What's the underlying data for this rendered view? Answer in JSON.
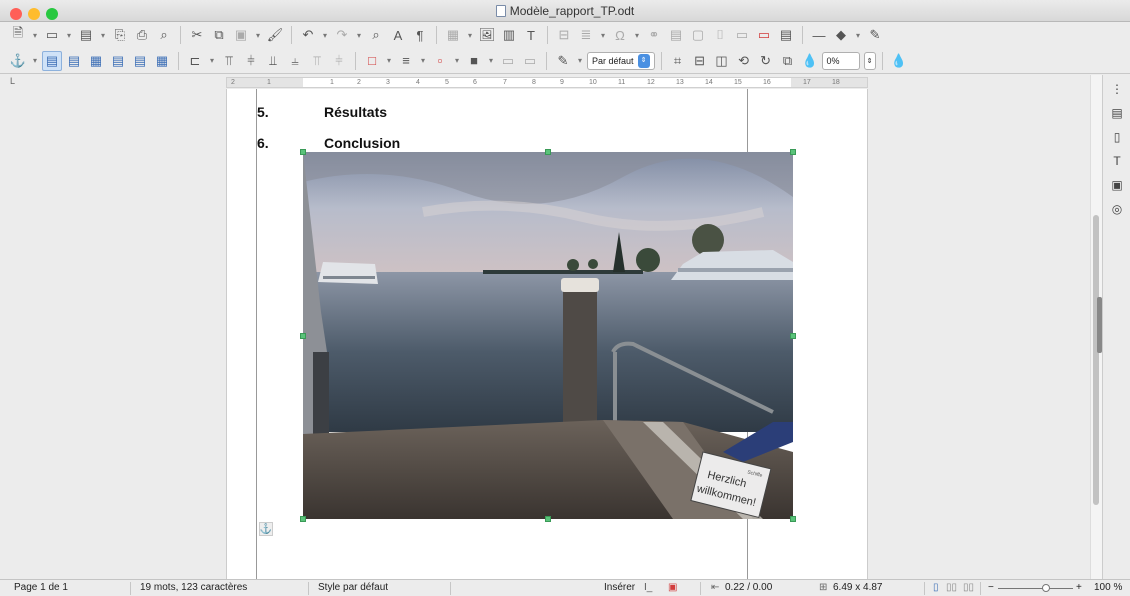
{
  "window": {
    "title": "Modèle_rapport_TP.odt"
  },
  "colors": {
    "close": "#ff5f57",
    "minimize": "#febc2e",
    "maximize": "#28c840",
    "selection_handle": "#5ac37a"
  },
  "toolbar1": {
    "icons": [
      "new-document-icon",
      "open-icon",
      "save-icon",
      "export-pdf-icon",
      "print-icon",
      "print-preview-icon",
      "cut-icon",
      "copy-icon",
      "paste-icon",
      "clone-formatting-icon",
      "undo-icon",
      "redo-icon",
      "find-replace-icon",
      "spelling-icon",
      "formatting-marks-icon",
      "table-icon",
      "image-icon",
      "chart-icon",
      "text-box-icon",
      "page-break-icon",
      "field-icon",
      "special-character-icon",
      "hyperlink-icon",
      "footnote-icon",
      "endnote-icon",
      "bookmark-icon",
      "cross-reference-icon",
      "comment-icon",
      "track-changes-icon",
      "line-icon",
      "shapes-icon",
      "draw-icon"
    ]
  },
  "toolbar2": {
    "style_value": "Par défaut",
    "transparency_value": "0%",
    "icons": [
      "anchor-icon",
      "wrap-off-icon",
      "page-wrap-icon",
      "optimal-wrap-icon",
      "wrap-left-icon",
      "wrap-right-icon",
      "wrap-through-icon",
      "align-icon",
      "bring-front-icon",
      "send-back-icon",
      "borders-icon",
      "line-style-icon",
      "border-color-icon",
      "area-icon",
      "transparency-icon"
    ]
  },
  "ruler": {
    "corner": "L",
    "ticks": [
      "2",
      "1",
      "",
      "1",
      "2",
      "3",
      "4",
      "5",
      "6",
      "7",
      "8",
      "9",
      "10",
      "11",
      "12",
      "13",
      "14",
      "15",
      "16",
      "17",
      "18"
    ]
  },
  "document": {
    "headings": [
      {
        "number": "5.",
        "text": "Résultats"
      },
      {
        "number": "6.",
        "text": "Conclusion"
      }
    ],
    "image": {
      "sign_line1": "Herzlich",
      "sign_line2": "willkommen!",
      "sign_small": "Schiffe"
    }
  },
  "sidebar": {
    "icons": [
      "sidebar-menu-icon",
      "properties-icon",
      "page-icon",
      "styles-icon",
      "gallery-icon",
      "navigator-icon"
    ]
  },
  "status": {
    "page": "Page 1 de 1",
    "words": "19 mots, 123 caractères",
    "style": "Style par défaut",
    "mode": "Insérer",
    "position": "0.22 / 0.00",
    "size": "6.49 x 4.87",
    "zoom_minus": "−",
    "zoom_plus": "+",
    "zoom": "100 %"
  }
}
